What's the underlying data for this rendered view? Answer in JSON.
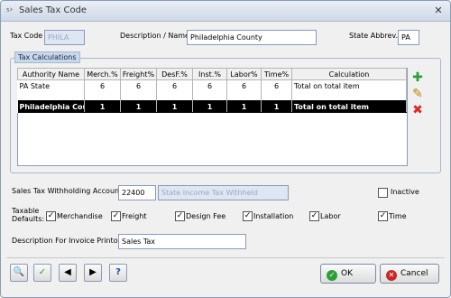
{
  "window": {
    "title": "Sales Tax Code",
    "close_glyph": "✕"
  },
  "header": {
    "tax_code_label": "Tax Code",
    "tax_code_value": "PHILA",
    "description_label": "Description / Name",
    "description_value": "Philadelphia County",
    "state_abbrev_label": "State Abbrev.",
    "state_abbrev_value": "PA"
  },
  "tax_calc": {
    "group_title": "Tax Calculations",
    "columns": [
      "Authority Name",
      "Merch.%",
      "Freight%",
      "DesF.%",
      "Inst.%",
      "Labor%",
      "Time%",
      "Calculation"
    ],
    "rows": [
      [
        "PA State",
        "6",
        "6",
        "6",
        "6",
        "6",
        "6",
        "Total on total item"
      ],
      [
        "Philadelphia County",
        "1",
        "1",
        "1",
        "1",
        "1",
        "1",
        "Total on total item"
      ]
    ],
    "selected_row": 1,
    "add_icon": "plus-icon",
    "edit_icon": "pencil-icon",
    "delete_icon": "delete-x-icon"
  },
  "withholding": {
    "label": "Sales Tax Withholding Account",
    "account_value": "22400",
    "account_name": "State Income Tax Withheld",
    "inactive_label": "Inactive",
    "inactive_checked": false
  },
  "defaults": {
    "label_line1": "Taxable",
    "label_line2": "Defaults:",
    "items": [
      {
        "label": "Merchandise",
        "checked": true
      },
      {
        "label": "Freight",
        "checked": true
      },
      {
        "label": "Design Fee",
        "checked": true
      },
      {
        "label": "Installation",
        "checked": true
      },
      {
        "label": "Labor",
        "checked": true
      },
      {
        "label": "Time",
        "checked": true
      }
    ]
  },
  "invoice": {
    "label": "Description For Invoice Printout",
    "value": "Sales Tax"
  },
  "footer": {
    "ok_label": "OK",
    "cancel_label": "Cancel",
    "help_glyph": "?"
  },
  "colors": {
    "ok_icon": "#2e9e3a",
    "cancel_icon": "#c62828",
    "add_icon": "#2e9e3a",
    "delete_icon": "#d32f2f"
  }
}
